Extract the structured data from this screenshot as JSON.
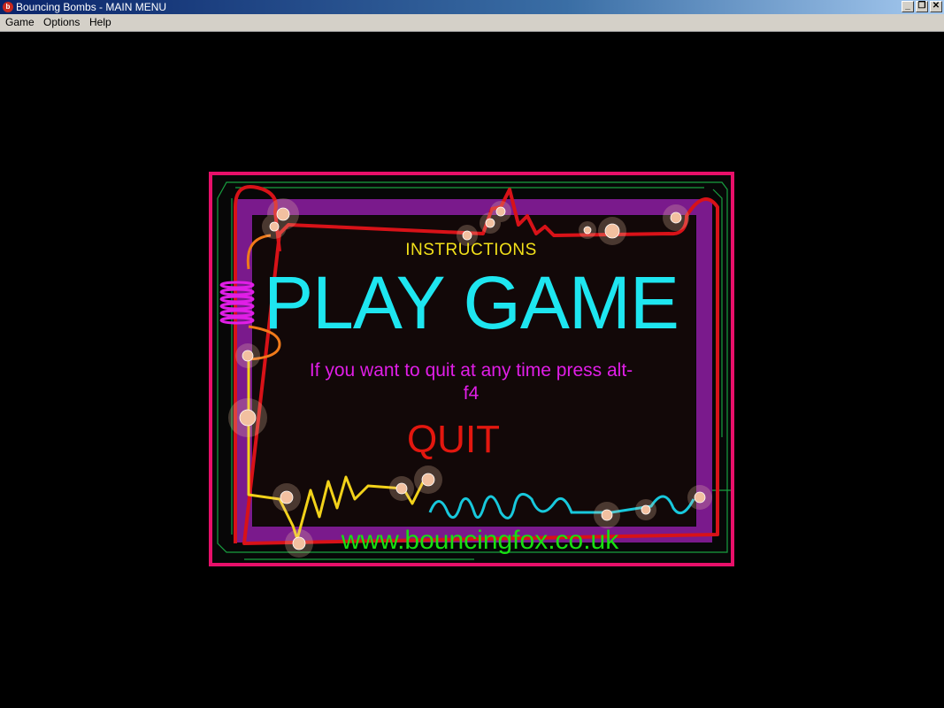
{
  "window": {
    "title": "Bouncing Bombs - MAIN MENU",
    "app_icon": "bomb-icon",
    "controls": [
      "minimize-icon",
      "restore-icon",
      "close-icon"
    ]
  },
  "menubar": {
    "items": [
      "Game",
      "Options",
      "Help"
    ]
  },
  "main_menu": {
    "instructions": "INSTRUCTIONS",
    "play_game": "PLAY GAME",
    "quit_message": "If you want to quit at any time press alt-f4",
    "quit": "QUIT",
    "website": "www.bouncingfox.co.uk"
  },
  "colors": {
    "frame": "#e8106a",
    "inner_frame": "#7a1a8c",
    "instructions": "#f2e01a",
    "play_game": "#1ee6f0",
    "quit_message": "#e01ee6",
    "quit": "#e3170f",
    "website": "#18e012"
  }
}
